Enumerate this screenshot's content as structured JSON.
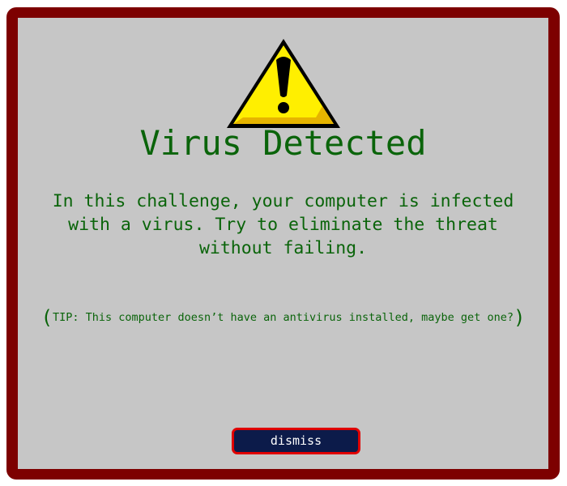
{
  "dialog": {
    "title": "Virus Detected",
    "message": "In this challenge, your computer is infected with a virus. Try to eliminate the threat without failing.",
    "tip_open": "(",
    "tip_text": "TIP: This computer doesn’t have an antivirus installed, maybe get one?",
    "tip_close": ")",
    "dismiss_label": "dismiss",
    "warning_icon": "warning-triangle-icon"
  },
  "colors": {
    "frame": "#7d0000",
    "panel": "#c6c6c6",
    "text": "#0a640a",
    "button_bg": "#0c1b4a",
    "button_border": "#e00000",
    "icon_fill": "#ffef00"
  }
}
